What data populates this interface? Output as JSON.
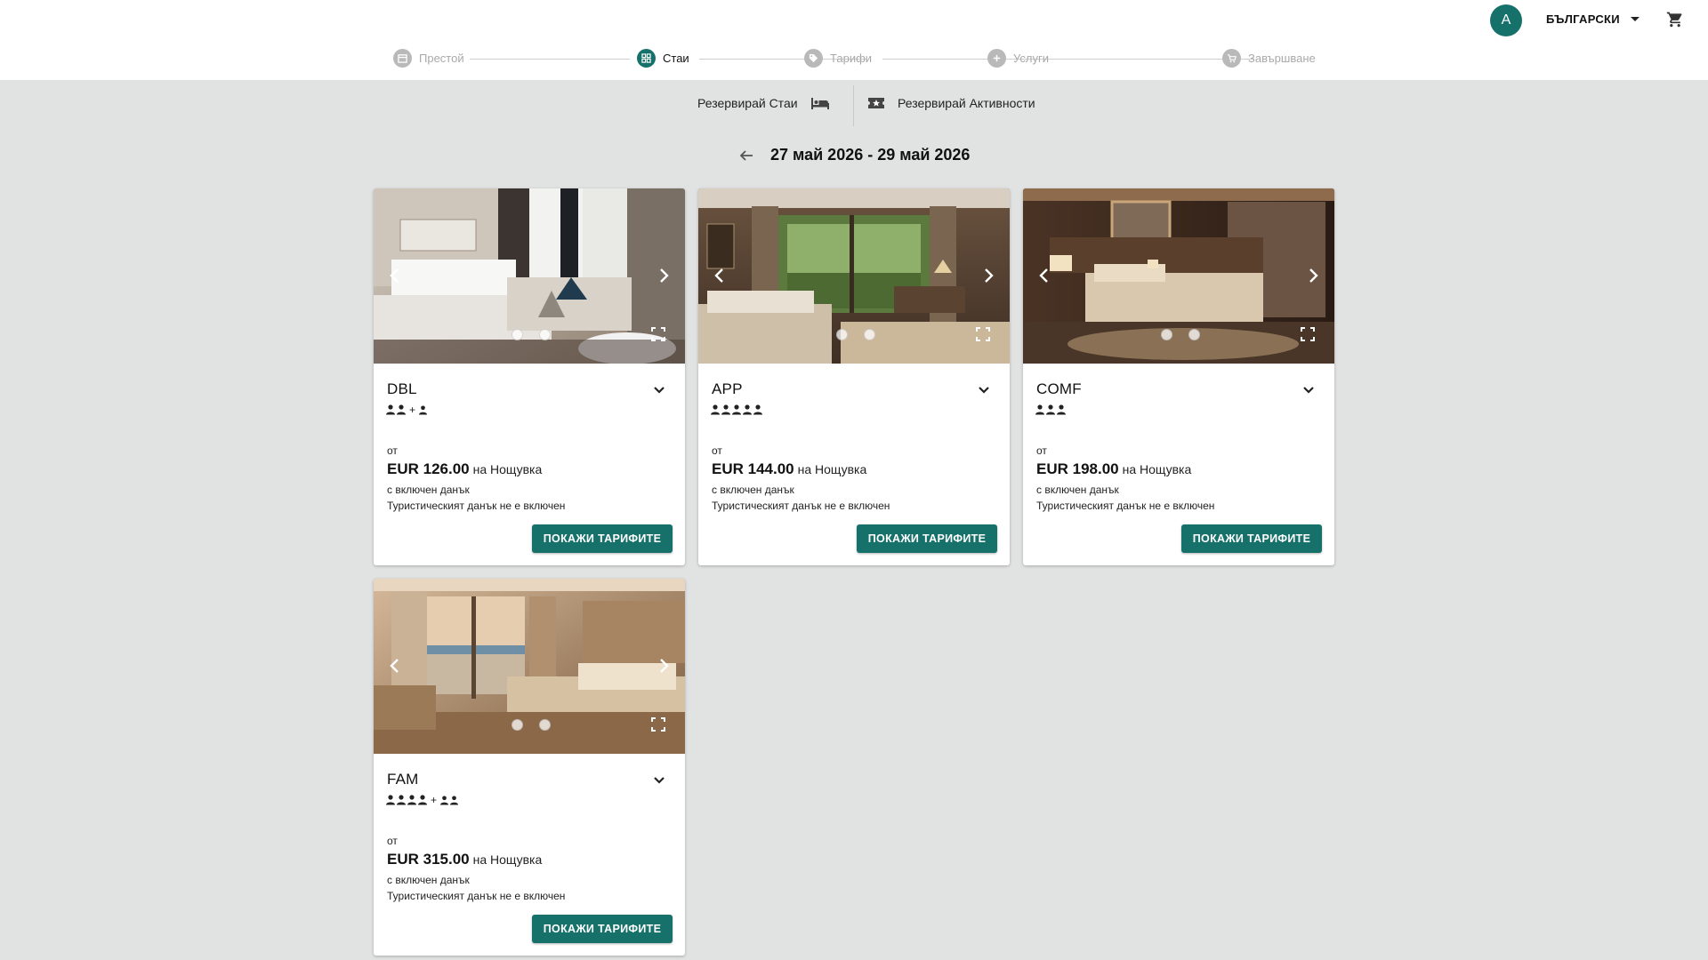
{
  "header": {
    "avatar_initial": "A",
    "language": "БЪЛГАРСКИ"
  },
  "stepper": {
    "steps": [
      {
        "label": "Престой",
        "icon": "calendar-icon"
      },
      {
        "label": "Стаи",
        "icon": "grid-icon"
      },
      {
        "label": "Тарифи",
        "icon": "tag-icon"
      },
      {
        "label": "Услуги",
        "icon": "plus-icon"
      },
      {
        "label": "Завършване",
        "icon": "cart-check-icon"
      }
    ],
    "active_index": 1
  },
  "booking_tabs": {
    "rooms": "Резервирай Стаи",
    "activities": "Резервирай Активности"
  },
  "dates": {
    "range": "27 май 2026 - 29 май 2026"
  },
  "colors": {
    "accent": "#17716b",
    "background": "#e1e2e2"
  },
  "rooms": [
    {
      "code": "DBL",
      "adults": 2,
      "children": 1,
      "from_label": "от",
      "price": "EUR 126.00",
      "per_night": "на Нощувка",
      "tax_included": "с включен данък",
      "tourist_tax": "Туристическият данък не е включен",
      "button": "ПОКАЖИ ТАРИФИТЕ",
      "photo_count": 2
    },
    {
      "code": "APP",
      "adults": 5,
      "children": 0,
      "from_label": "от",
      "price": "EUR 144.00",
      "per_night": "на Нощувка",
      "tax_included": "с включен данък",
      "tourist_tax": "Туристическият данък не е включен",
      "button": "ПОКАЖИ ТАРИФИТЕ",
      "photo_count": 2
    },
    {
      "code": "COMF",
      "adults": 3,
      "children": 0,
      "from_label": "от",
      "price": "EUR 198.00",
      "per_night": "на Нощувка",
      "tax_included": "с включен данък",
      "tourist_tax": "Туристическият данък не е включен",
      "button": "ПОКАЖИ ТАРИФИТЕ",
      "photo_count": 2
    },
    {
      "code": "FAM",
      "adults": 4,
      "children": 2,
      "from_label": "от",
      "price": "EUR 315.00",
      "per_night": "на Нощувка",
      "tax_included": "с включен данък",
      "tourist_tax": "Туристическият данък не е включен",
      "button": "ПОКАЖИ ТАРИФИТЕ",
      "photo_count": 2
    }
  ]
}
